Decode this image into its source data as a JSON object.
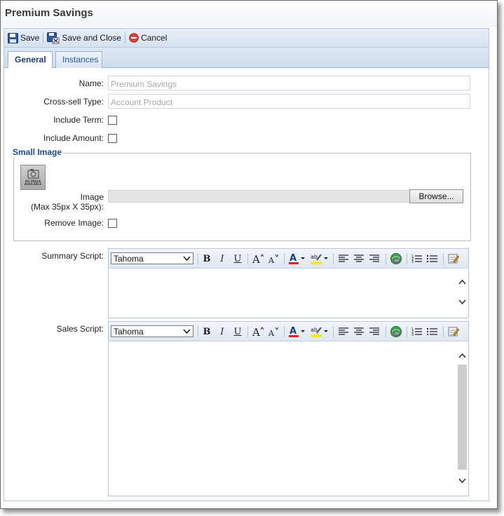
{
  "window": {
    "title": "Premium Savings"
  },
  "toolbar": {
    "save_label": "Save",
    "save_close_label": "Save and Close",
    "cancel_label": "Cancel"
  },
  "tabs": [
    {
      "label": "General",
      "active": true
    },
    {
      "label": "Instances",
      "active": false
    }
  ],
  "form": {
    "name_label": "Name:",
    "name_value": "Premium Savings",
    "crosssell_label": "Cross-sell Type:",
    "crosssell_value": "Account Product",
    "include_term_label": "Include Term:",
    "include_term_checked": false,
    "include_amount_label": "Include Amount:",
    "include_amount_checked": false
  },
  "small_image": {
    "legend": "Small Image",
    "placeholder_text": "NO IMAGE AVAILABLE",
    "image_label": "Image",
    "image_hint": "(Max 35px X 35px):",
    "browse_label": "Browse...",
    "remove_label": "Remove Image:",
    "remove_checked": false
  },
  "summary_script": {
    "label": "Summary Script:",
    "font": "Tahoma"
  },
  "sales_script": {
    "label": "Sales Script:",
    "font": "Tahoma"
  },
  "colors": {
    "accent": "#1d4a8a",
    "tab_text": "#2a5aa2",
    "toolbar_bg": "#d6e1f0"
  }
}
